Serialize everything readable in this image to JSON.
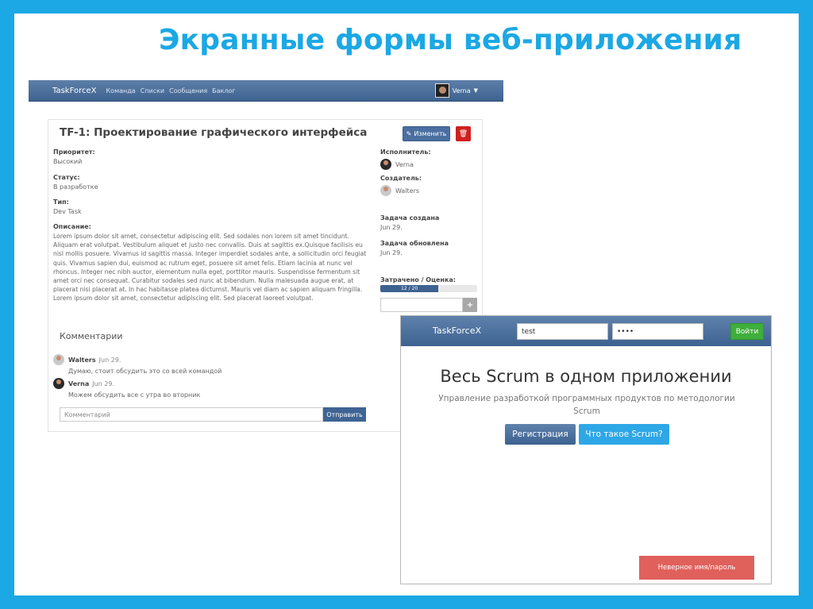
{
  "slide": {
    "title": "Экранные формы веб-приложения"
  },
  "task_screen": {
    "navbar": {
      "brand": "TaskForceX",
      "links": [
        "Команда",
        "Списки",
        "Сообщения",
        "Баклог"
      ],
      "user": "Verna"
    },
    "task": {
      "title": "TF-1: Проектирование графического интерфейса",
      "edit_label": "Изменить",
      "priority_label": "Приоритет:",
      "priority_value": "Высокий",
      "status_label": "Статус:",
      "status_value": "В разработке",
      "type_label": "Тип:",
      "type_value": "Dev Task",
      "description_label": "Описание:",
      "description": "Lorem ipsum dolor sit amet, consectetur adipiscing elit. Sed sodales non lorem sit amet tincidunt. Aliquam erat volutpat. Vestibulum aliquet et justo nec convallis. Duis at sagittis ex.Quisque facilisis eu nisl mollis posuere. Vivamus id sagittis massa. Integer imperdiet sodales ante, a sollicitudin orci feugiat quis. Vivamus sapien dui, euismod ac rutrum eget, posuere sit amet felis. Etiam lacinia at nunc vel rhoncus. Integer nec nibh auctor, elementum nulla eget, porttitor mauris. Suspendisse fermentum sit amet orci nec consequat. Curabitur sodales sed nunc at bibendum. Nulla malesuada augue erat, at placerat nisi placerat at. In hac habitasse platea dictumst. Mauris vel diam ac sapien aliquam fringilla. Lorem ipsum dolor sit amet, consectetur adipiscing elit. Sed placerat laoreet volutpat.",
      "assignee_label": "Исполнитель:",
      "assignee": "Verna",
      "creator_label": "Создатель:",
      "creator": "Walters",
      "created_label": "Задача создана",
      "created_value": "Jun 29.",
      "updated_label": "Задача обновлена",
      "updated_value": "Jun 29.",
      "spent_label": "Затрачено / Оценка:",
      "progress_text": "12 / 20",
      "progress_fraction": 0.6,
      "add_icon": "+"
    },
    "comments": {
      "title": "Комментарии",
      "items": [
        {
          "author": "Walters",
          "date": "Jun 29.",
          "text": "Думаю, стоит обсудить это со всей командой"
        },
        {
          "author": "Verna",
          "date": "Jun 29.",
          "text": "Можем обсудить все с утра во вторник"
        }
      ],
      "input_placeholder": "Комментарий",
      "send_label": "Отправить"
    }
  },
  "landing_screen": {
    "brand": "TaskForceX",
    "login_value": "test",
    "password_value": "••••",
    "login_button": "Войти",
    "hero_title": "Весь Scrum в одном приложении",
    "hero_subtitle": "Управление разработкой программных продуктов по методологии Scrum",
    "register_button": "Регистрация",
    "what_button": "Что такое Scrum?",
    "error_message": "Неверное имя/пароль"
  },
  "colors": {
    "accent": "#1ba8e4",
    "navbar": "#4a6fa0",
    "danger": "#d11f1f",
    "success": "#3fae3b",
    "error_toast": "#e0605c"
  }
}
